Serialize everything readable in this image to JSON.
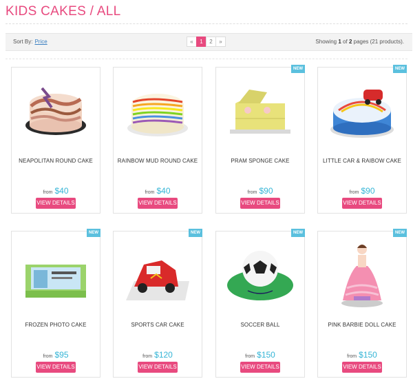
{
  "page": {
    "title": "KIDS CAKES / ALL"
  },
  "toolbar": {
    "sort_label": "Sort By:",
    "sort_link": "Price",
    "pager": {
      "prev": "«",
      "pages": [
        "1",
        "2"
      ],
      "active": "1",
      "next": "»"
    },
    "showing_prefix": "Showing",
    "showing_current": "1",
    "showing_of": "of",
    "showing_total": "2",
    "showing_suffix": "pages (21 products)."
  },
  "products": [
    {
      "name": "NEAPOLITAN ROUND CAKE",
      "from": "from",
      "price": "$40",
      "button": "VIEW DETAILS",
      "badge": "",
      "icon": "neapolitan-cake-icon"
    },
    {
      "name": "RAINBOW MUD ROUND CAKE",
      "from": "from",
      "price": "$40",
      "button": "VIEW DETAILS",
      "badge": "",
      "icon": "rainbow-cake-icon"
    },
    {
      "name": "PRAM SPONGE CAKE",
      "from": "from",
      "price": "$90",
      "button": "VIEW DETAILS",
      "badge": "NEW",
      "icon": "pram-cake-icon"
    },
    {
      "name": "LITTLE CAR & RAIBOW CAKE",
      "from": "from",
      "price": "$90",
      "button": "VIEW DETAILS",
      "badge": "NEW",
      "icon": "car-rainbow-cake-icon"
    },
    {
      "name": "FROZEN PHOTO CAKE",
      "from": "from",
      "price": "$95",
      "button": "VIEW DETAILS",
      "badge": "NEW",
      "icon": "photo-cake-icon"
    },
    {
      "name": "SPORTS CAR CAKE",
      "from": "from",
      "price": "$120",
      "button": "VIEW DETAILS",
      "badge": "NEW",
      "icon": "sports-car-cake-icon"
    },
    {
      "name": "SOCCER BALL",
      "from": "from",
      "price": "$150",
      "button": "VIEW DETAILS",
      "badge": "NEW",
      "icon": "soccer-ball-cake-icon"
    },
    {
      "name": "PINK BARBIE DOLL CAKE",
      "from": "from",
      "price": "$150",
      "button": "VIEW DETAILS",
      "badge": "NEW",
      "icon": "barbie-doll-cake-icon"
    }
  ],
  "colors": {
    "accent": "#e84a7f",
    "price": "#35b5d6",
    "badge": "#5bc0de",
    "link": "#3a7fc1"
  }
}
